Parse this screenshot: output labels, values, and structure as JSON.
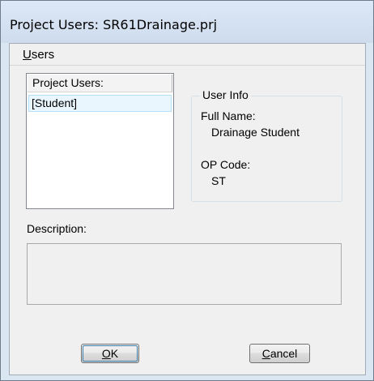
{
  "window": {
    "title": "Project Users: SR61Drainage.prj"
  },
  "menu": {
    "users_label": "Users"
  },
  "users_list": {
    "header": "Project Users:",
    "items": [
      "[Student]"
    ]
  },
  "user_info": {
    "legend": "User Info",
    "full_name_label": "Full Name:",
    "full_name_value": "Drainage Student",
    "op_code_label": "OP Code:",
    "op_code_value": "ST"
  },
  "description": {
    "label": "Description:",
    "value": ""
  },
  "buttons": {
    "ok_label": "OK",
    "cancel_label": "Cancel"
  },
  "colors": {
    "frame": "#dbe6f3",
    "dialog_bg": "#f0f0f0",
    "selection_bg": "#eaf6fd",
    "selection_border": "#b6e0f7"
  }
}
